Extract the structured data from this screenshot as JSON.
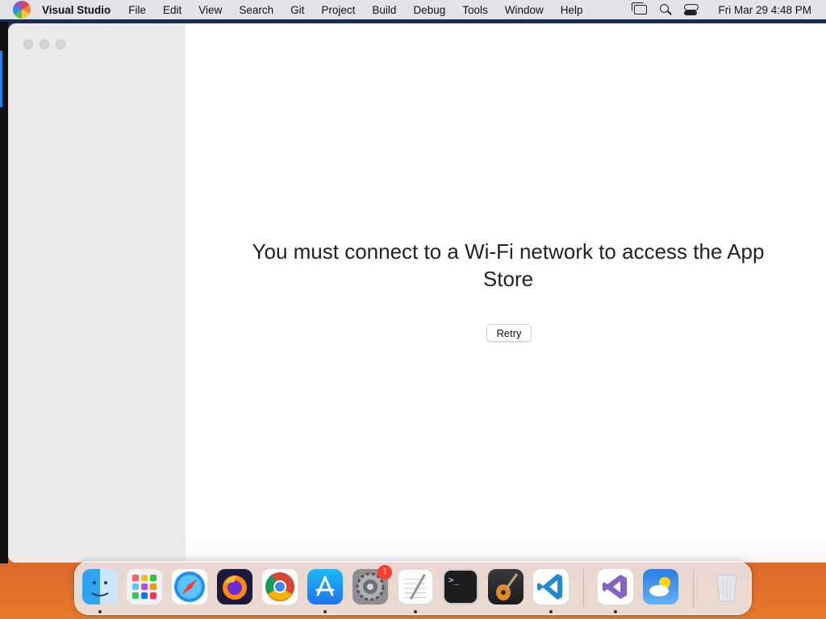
{
  "menubar": {
    "app_name": "Visual Studio",
    "items": [
      "File",
      "Edit",
      "View",
      "Search",
      "Git",
      "Project",
      "Build",
      "Debug",
      "Tools",
      "Window",
      "Help"
    ],
    "clock": "Fri Mar 29  4:48 PM"
  },
  "window": {
    "message": "You must connect to a Wi-Fi network to access the App Store",
    "retry_label": "Retry"
  },
  "dock": {
    "apps": [
      "finder",
      "launchpad",
      "safari",
      "firefox",
      "chrome",
      "app-store",
      "system-settings",
      "textedit",
      "terminal",
      "garageband",
      "vscode",
      "visual-studio",
      "weather",
      "trash"
    ],
    "settings_badge": "1",
    "terminal_prompt": ">_"
  },
  "colors": {
    "accent": "#2f7de1",
    "badge": "#ff3b30",
    "sidebar": "#ebebec"
  }
}
